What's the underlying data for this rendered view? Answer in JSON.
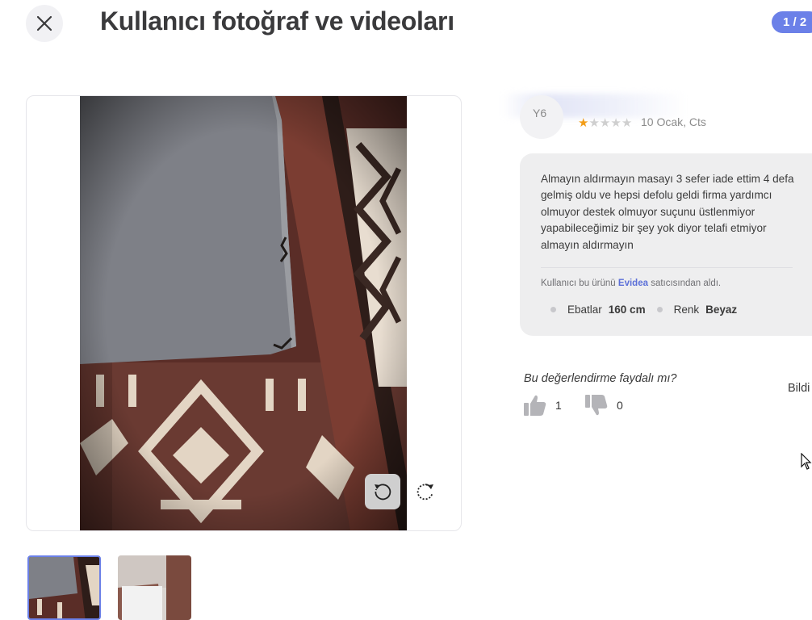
{
  "modal": {
    "title": "Kullanıcı fotoğraf ve videoları",
    "counter": "1 / 2"
  },
  "icons": {
    "close": "close-icon",
    "rotate_left": "rotate-left-icon",
    "rotate_right": "rotate-right-icon",
    "thumbs_up": "thumbs-up-icon",
    "thumbs_down": "thumbs-down-icon"
  },
  "review": {
    "avatar_text": "Y6",
    "rating": 1,
    "max_rating": 5,
    "date": "10 Ocak, Cts",
    "text": "Almayın aldırmayın masayı 3 sefer iade ettim 4 defa gelmiş oldu ve hepsi defolu geldi firma yardımcı olmuyor destek olmuyor suçunu üstlenmiyor yapabileceğimiz bir şey yok diyor telafi etmiyor almayın aldırmayın",
    "seller_prefix": "Kullanıcı bu ürünü",
    "seller_name": "Evidea",
    "seller_suffix": "satıcısından aldı.",
    "attributes": [
      {
        "label": "Ebatlar",
        "value": "160 cm"
      },
      {
        "label": "Renk",
        "value": "Beyaz"
      }
    ]
  },
  "helpful": {
    "question": "Bu değerlendirme faydalı mı?",
    "report_label": "Bildi",
    "likes": "1",
    "dislikes": "0"
  },
  "colors": {
    "accent": "#6b80e8",
    "star_on": "#f29d18",
    "star_off": "#cfcfcf",
    "review_bg": "#eeeeef"
  }
}
